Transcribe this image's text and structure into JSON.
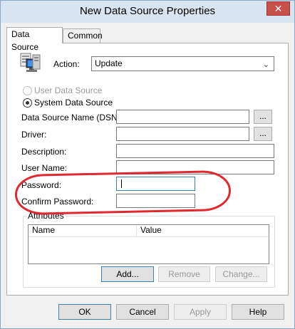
{
  "window": {
    "title": "New Data Source Properties",
    "close_glyph": "✕"
  },
  "tabs": [
    {
      "label": "Data Source"
    },
    {
      "label": "Common"
    }
  ],
  "action": {
    "label": "Action:",
    "selected": "Update"
  },
  "radios": {
    "user": {
      "label": "User Data Source",
      "checked": false,
      "enabled": false
    },
    "system": {
      "label": "System Data Source",
      "checked": true,
      "enabled": true
    }
  },
  "fields": {
    "dsn": {
      "label": "Data Source Name (DSN):",
      "value": ""
    },
    "driver": {
      "label": "Driver:",
      "value": ""
    },
    "description": {
      "label": "Description:",
      "value": ""
    },
    "username": {
      "label": "User Name:",
      "value": ""
    },
    "password": {
      "label": "Password:",
      "value": ""
    },
    "confirm_password": {
      "label": "Confirm Password:",
      "value": ""
    }
  },
  "browse_label": "...",
  "attributes": {
    "group_title": "Attributes",
    "columns": [
      "Name",
      "Value"
    ],
    "buttons": {
      "add": "Add...",
      "remove": "Remove",
      "change": "Change..."
    }
  },
  "footer": {
    "ok": "OK",
    "cancel": "Cancel",
    "apply": "Apply",
    "help": "Help"
  },
  "icons": {
    "action_icon": "data-source-computer-icon"
  },
  "colors": {
    "annotation": "#e0282e",
    "titlebar": "#d7e4f2",
    "close": "#c7504a"
  }
}
